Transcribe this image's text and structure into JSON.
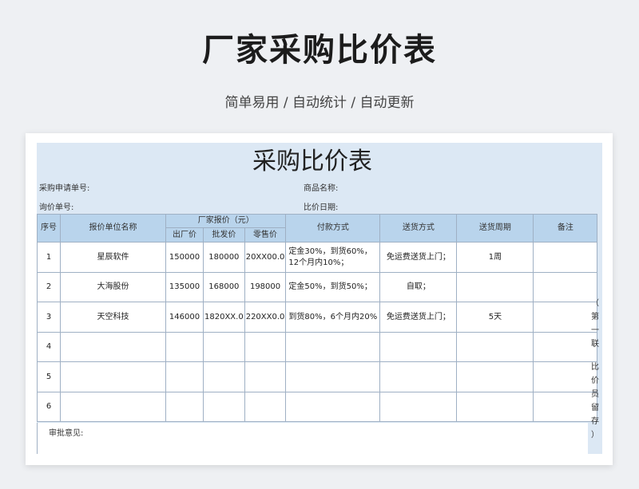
{
  "hero": {
    "title": "厂家采购比价表",
    "subtitle": "简单易用  /  自动统计  /  自动更新"
  },
  "form": {
    "title": "采购比价表",
    "fields": {
      "purchase_request_no": "采购申请单号:",
      "product_name": "商品名称:",
      "inquiry_no": "询价单号:",
      "compare_date": "比价日期:"
    },
    "headers": {
      "seq": "序号",
      "vendor": "报价单位名称",
      "quote_group": "厂家报价（元）",
      "factory_price": "出厂价",
      "wholesale_price": "批发价",
      "retail_price": "零售价",
      "payment": "付款方式",
      "delivery": "送货方式",
      "period": "送货周期",
      "remark": "备注"
    },
    "rows": [
      {
        "seq": "1",
        "vendor": "星辰软件",
        "factory": "150000",
        "wholesale": "180000",
        "retail": "20XX00.0",
        "payment": "定金30%，到货60%，12个月内10%；",
        "delivery": "免运费送货上门；",
        "period": "1周",
        "remark": ""
      },
      {
        "seq": "2",
        "vendor": "大海股份",
        "factory": "135000",
        "wholesale": "168000",
        "retail": "198000",
        "payment": "定金50%，到货50%；",
        "delivery": "自取；",
        "period": "",
        "remark": ""
      },
      {
        "seq": "3",
        "vendor": "天空科技",
        "factory": "146000",
        "wholesale": "1820XX.0",
        "retail": "220XX0.0",
        "payment": "到货80%，6个月内20%",
        "delivery": "免运费送货上门；",
        "period": "5天",
        "remark": ""
      },
      {
        "seq": "4",
        "vendor": "",
        "factory": "",
        "wholesale": "",
        "retail": "",
        "payment": "",
        "delivery": "",
        "period": "",
        "remark": ""
      },
      {
        "seq": "5",
        "vendor": "",
        "factory": "",
        "wholesale": "",
        "retail": "",
        "payment": "",
        "delivery": "",
        "period": "",
        "remark": ""
      },
      {
        "seq": "6",
        "vendor": "",
        "factory": "",
        "wholesale": "",
        "retail": "",
        "payment": "",
        "delivery": "",
        "period": "",
        "remark": ""
      }
    ],
    "approval_label": "审批意见:",
    "side_note": [
      "（",
      "第",
      "一",
      "联",
      "",
      "比",
      "价",
      "员",
      "留",
      "存",
      "）"
    ]
  }
}
